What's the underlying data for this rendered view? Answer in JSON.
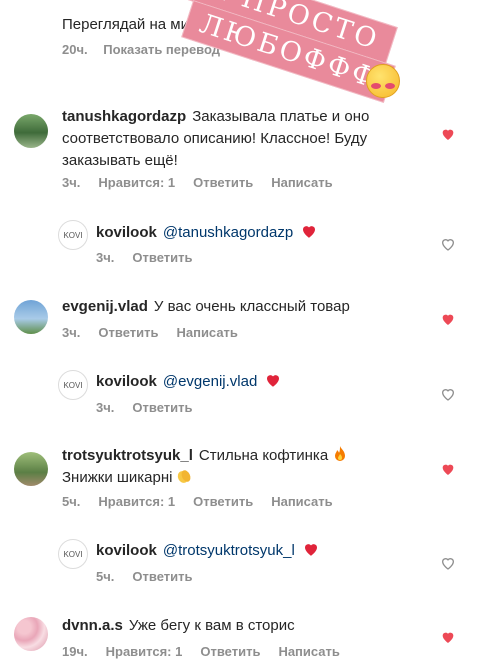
{
  "top_comment": {
    "text": "Переглядай на                                  ми знижками",
    "time": "20ч.",
    "translate": "Показать перевод"
  },
  "sticker": {
    "line1": "И ПРОСТО",
    "line2": "ЛЮБОФФФ"
  },
  "comments": [
    {
      "username": "tanushkagordazp",
      "text": "Заказывала платье и оно соответствовало описанию! Классное! Буду заказывать ещё!",
      "time": "3ч.",
      "likes": "Нравится: 1",
      "reply": "Ответить",
      "message": "Написать",
      "liked": true
    },
    {
      "username": "kovilook",
      "mention": "@tanushkagordazp",
      "time": "3ч.",
      "reply": "Ответить",
      "liked": false
    },
    {
      "username": "evgenij.vlad",
      "text": "У вас очень классный товар",
      "time": "3ч.",
      "reply": "Ответить",
      "message": "Написать",
      "liked": true
    },
    {
      "username": "kovilook",
      "mention": "@evgenij.vlad",
      "time": "3ч.",
      "reply": "Ответить",
      "liked": false
    },
    {
      "username": "trotsyuktrotsyuk_l",
      "text": "Стильна кофтинка",
      "text2": "Знижки шикарні",
      "time": "5ч.",
      "likes": "Нравится: 1",
      "reply": "Ответить",
      "message": "Написать",
      "liked": true
    },
    {
      "username": "kovilook",
      "mention": "@trotsyuktrotsyuk_l",
      "time": "5ч.",
      "reply": "Ответить",
      "liked": false
    },
    {
      "username": "dvnn.a.s",
      "text": "Уже бегу к вам в сторис",
      "time": "19ч.",
      "likes": "Нравится: 1",
      "reply": "Ответить",
      "message": "Написать",
      "liked": true
    }
  ],
  "avatar_label": "KOVI",
  "colors": {
    "like": "#ed4956",
    "meta": "#8e8e8e",
    "mention": "#00376b",
    "sticker": "#e98a9b"
  },
  "icons": {
    "like_filled": "heart-filled-icon",
    "like_outline": "heart-outline-icon"
  }
}
